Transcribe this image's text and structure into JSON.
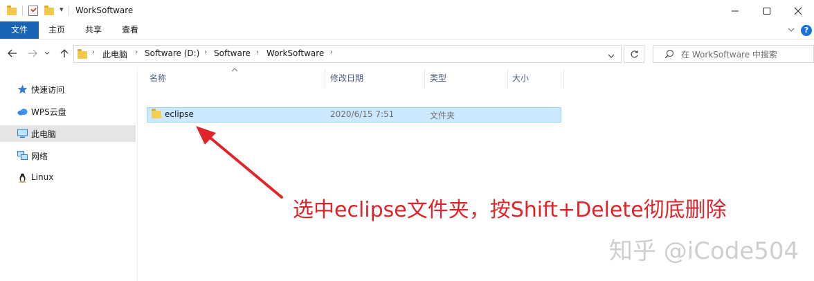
{
  "window": {
    "title": "WorkSoftware",
    "qa_dropdown_glyph": "▾"
  },
  "ribbon": {
    "tabs": [
      "文件",
      "主页",
      "共享",
      "查看"
    ],
    "help_glyph": "?"
  },
  "address": {
    "crumbs": [
      "此电脑",
      "Software (D:)",
      "Software",
      "WorkSoftware"
    ],
    "search_placeholder": "在 WorkSoftware 中搜索"
  },
  "nav_pane": {
    "items": [
      {
        "label": "快速访问",
        "icon": "star-icon"
      },
      {
        "label": "WPS云盘",
        "icon": "cloud-icon"
      },
      {
        "label": "此电脑",
        "icon": "computer-icon"
      },
      {
        "label": "网络",
        "icon": "network-icon"
      },
      {
        "label": "Linux",
        "icon": "penguin-icon"
      }
    ],
    "selected_index": 2
  },
  "file_list": {
    "columns": [
      "名称",
      "修改日期",
      "类型",
      "大小"
    ],
    "rows": [
      {
        "name": "eclipse",
        "modified": "2020/6/15 7:51",
        "type": "文件夹",
        "size": ""
      }
    ]
  },
  "annotation": {
    "text": "选中eclipse文件夹，按Shift+Delete彻底删除",
    "color": "#e0252a"
  },
  "watermark": {
    "text": "知乎 @iCode504"
  },
  "colors": {
    "file_tab": "#1a64b8",
    "selection_fill": "#cce8ff",
    "selection_border": "#99d1ff",
    "folder": "#f3ce57"
  }
}
